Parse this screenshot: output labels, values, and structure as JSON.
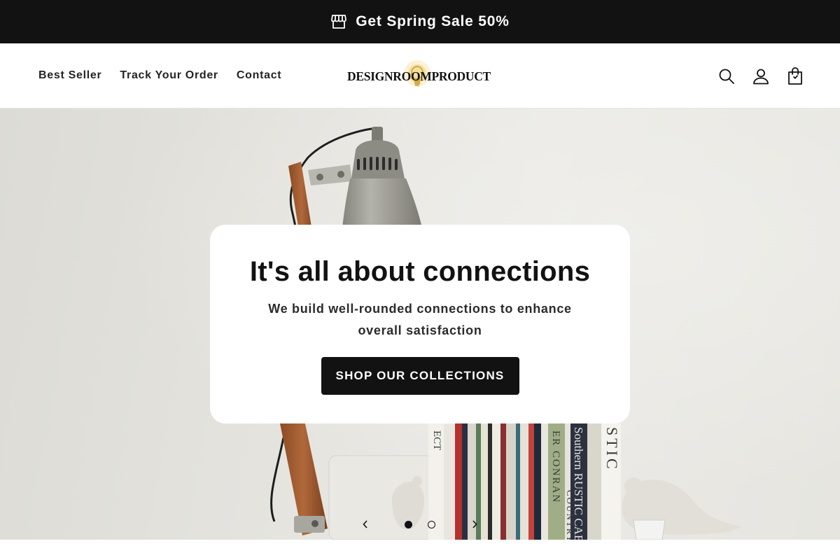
{
  "announcement": {
    "text": "Get Spring Sale 50%",
    "icon": "storefront-icon"
  },
  "header": {
    "nav": [
      {
        "label": "Best Seller"
      },
      {
        "label": "Track Your Order"
      },
      {
        "label": "Contact"
      }
    ],
    "logo_text": "DESIGNROOMPRODUCT",
    "icons": [
      "search-icon",
      "account-icon",
      "cart-icon"
    ]
  },
  "hero": {
    "title": "It's all about connections",
    "subtitle": "We build well-rounded connections to enhance overall satisfaction",
    "cta_label": "SHOP OUR COLLECTIONS",
    "slides_total": 2,
    "active_slide": 1,
    "book_spines": [
      "ECT",
      "ER CONRAN",
      "COUNTRY",
      "Southern RUSTIC CABIN",
      "STIC"
    ]
  },
  "colors": {
    "announcement_bg": "#121212",
    "text": "#121212",
    "button_bg": "#121212",
    "button_text": "#ffffff"
  }
}
